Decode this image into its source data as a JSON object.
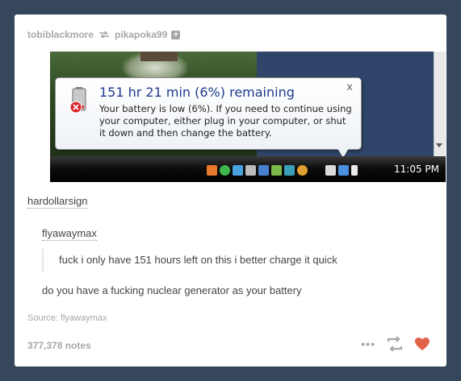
{
  "post": {
    "author": "tobiblackmore",
    "reblogged_from": "pikapoka99",
    "follow_glyph": "+",
    "notes": "377,378 notes",
    "source_label": "Source:",
    "source_user": "flyawaymax"
  },
  "screenshot": {
    "balloon_title": "151 hr 21 min (6%) remaining",
    "balloon_body": "Your battery is low (6%). If you need to continue using your computer, either plug in your computer, or shut it down and then change the battery.",
    "close_glyph": "x",
    "clock": "11:05 PM",
    "tray_icons": [
      "antivirus-icon",
      "spotify-icon",
      "shield-icon",
      "wrench-icon",
      "monitor-icon",
      "network-icon",
      "volume-icon",
      "battery-icon"
    ]
  },
  "thread": {
    "user1": "hardollarsign",
    "user2": "flyawaymax",
    "quote_text": "fuck i only have 151 hours left on this i better charge it quick",
    "reply_text": "do you have a fucking nuclear generator as your battery"
  },
  "colors": {
    "dashboard_bg": "#36465d",
    "like_heart": "#e2624a",
    "meta_gray": "#a7a7a7"
  }
}
